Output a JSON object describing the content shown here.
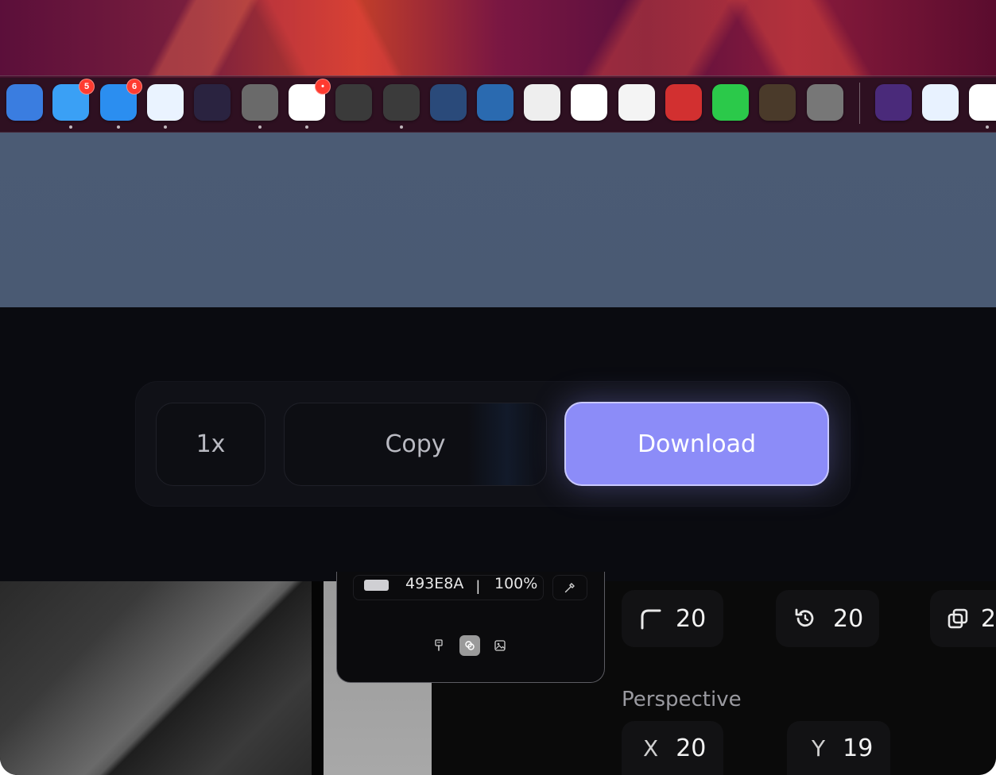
{
  "dock": {
    "apps": [
      {
        "name": "tasks-app-icon",
        "color": "#3a7de0"
      },
      {
        "name": "mail-app-icon",
        "color": "#3aa0f5",
        "badge": "5"
      },
      {
        "name": "airmail-app-icon",
        "color": "#2b8ef0",
        "badge": "6"
      },
      {
        "name": "safari-app-icon",
        "color": "#eaf3ff"
      },
      {
        "name": "firefox-app-icon",
        "color": "#2a2340"
      },
      {
        "name": "reeder-app-icon",
        "color": "#6a6a6a"
      },
      {
        "name": "slack-app-icon",
        "color": "#ffffff",
        "badge": "•"
      },
      {
        "name": "tweetbot-app-icon",
        "color": "#3a3a3a"
      },
      {
        "name": "tes-app-icon",
        "color": "#3b3b3b"
      },
      {
        "name": "screen-app-icon",
        "color": "#2a4a7a"
      },
      {
        "name": "kindle-app-icon",
        "color": "#2a6ab0"
      },
      {
        "name": "pixelmator-app-icon",
        "color": "#eeeeee"
      },
      {
        "name": "onenote-app-icon",
        "color": "#ffffff"
      },
      {
        "name": "textedit-app-icon",
        "color": "#f4f4f4"
      },
      {
        "name": "quicktime-app-icon",
        "color": "#d23030"
      },
      {
        "name": "messages-app-icon",
        "color": "#2bc94a"
      },
      {
        "name": "books-app-icon",
        "color": "#4a3a2a"
      },
      {
        "name": "settings-app-icon",
        "color": "#777777"
      },
      {
        "name": "app-store-app-icon",
        "color": "#4a2a7a"
      },
      {
        "name": "maps-app-icon",
        "color": "#e8f2ff"
      },
      {
        "name": "u-app-icon",
        "color": "#ffffff"
      }
    ]
  },
  "export": {
    "scale_label": "1x",
    "copy_label": "Copy",
    "download_label": "Download"
  },
  "color_picker": {
    "hex": "493E8A",
    "separator": "|",
    "opacity": "100%"
  },
  "properties": {
    "corner_radius": "20",
    "rotation": "20",
    "third_value": "2",
    "perspective_label": "Perspective",
    "x_label": "X",
    "x_value": "20",
    "y_label": "Y",
    "y_value": "19"
  },
  "colors": {
    "accent": "#8c8cf8",
    "panel": "#0a0b10"
  }
}
